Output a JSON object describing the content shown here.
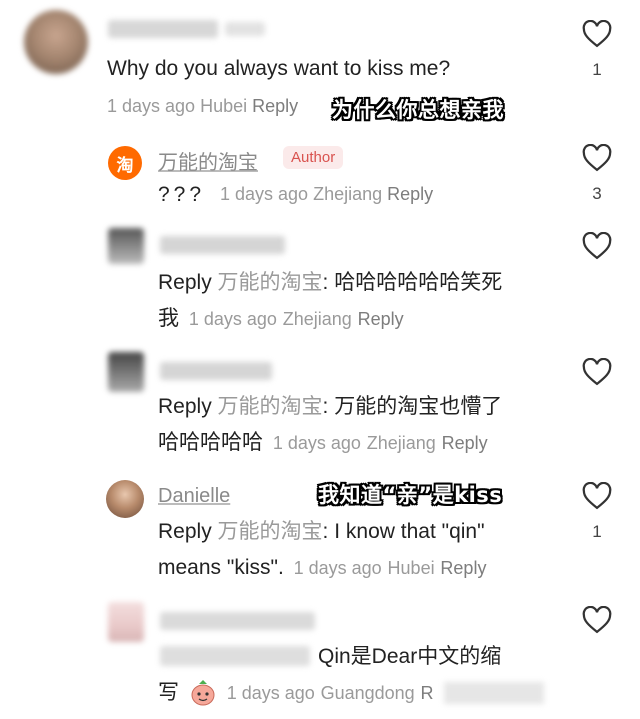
{
  "comments": [
    {
      "text": "Why do you always want to kiss me?",
      "time": "1 days ago",
      "location": "Hubei",
      "reply_label": "Reply",
      "likes": "1",
      "annotation": "为什么你总想亲我"
    },
    {
      "author": "万能的淘宝",
      "badge": "Author",
      "logo_char": "淘",
      "text": "???",
      "time": "1 days ago",
      "location": "Zhejiang",
      "reply_label": "Reply",
      "likes": "3"
    },
    {
      "reply_prefix": "Reply",
      "reply_to": "万能的淘宝",
      "text_line1": "哈哈哈哈哈哈笑死",
      "text_line2": "我",
      "time": "1 days ago",
      "location": "Zhejiang",
      "reply_label": "Reply"
    },
    {
      "reply_prefix": "Reply",
      "reply_to": "万能的淘宝",
      "text_line1": "万能的淘宝也懵了",
      "text_line2": "哈哈哈哈哈",
      "time": "1 days ago",
      "location": "Zhejiang",
      "reply_label": "Reply"
    },
    {
      "author": "Danielle",
      "annotation": "我知道“亲”是kiss",
      "reply_prefix": "Reply",
      "reply_to": "万能的淘宝",
      "text_line1": "I know that \"qin\"",
      "text_line2": "means \"kiss\".",
      "time": "1 days ago",
      "location": "Hubei",
      "reply_label": "Reply",
      "likes": "1"
    },
    {
      "text_line1": "Qin是Dear中文的缩",
      "text_line2": "写",
      "time": "1 days ago",
      "location": "Guangdong",
      "reply_label": "R"
    }
  ],
  "colors": {
    "text": "#222222",
    "meta": "#9a9a9a",
    "author_badge_bg": "#fbeaea",
    "author_badge_text": "#d9534f",
    "taobao_orange": "#ff6a00"
  },
  "icons": [
    "heart-icon",
    "taobao-logo-icon",
    "avatar",
    "emoji-sticker-icon"
  ]
}
